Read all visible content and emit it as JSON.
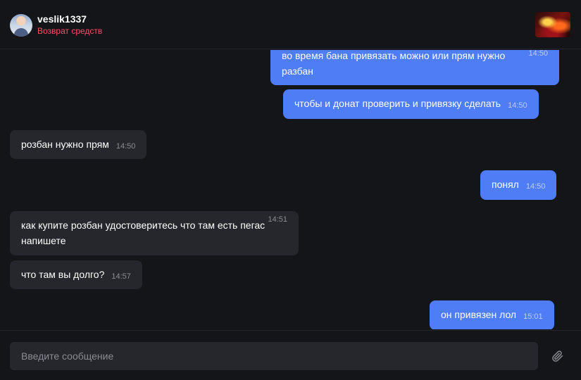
{
  "header": {
    "username": "veslik1337",
    "status": "Возврат средств",
    "status_color": "#ff4d6a"
  },
  "colors": {
    "background": "#141518",
    "outgoing_bubble": "#4f7df5",
    "incoming_bubble": "#26272d"
  },
  "messages": [
    {
      "direction": "outgoing",
      "text": "во время бана привязать можно или прям нужно разбан",
      "time": "14:50"
    },
    {
      "direction": "outgoing",
      "text": "чтобы и донат проверить и привязку сделать",
      "time": "14:50"
    },
    {
      "direction": "incoming",
      "text": "розбан нужно прям",
      "time": "14:50"
    },
    {
      "direction": "outgoing",
      "text": "понял",
      "time": "14:50"
    },
    {
      "direction": "incoming",
      "text": "как купите розбан удостоверитесь что там есть пегас напишете",
      "time": "14:51"
    },
    {
      "direction": "incoming",
      "text": "что там вы долго?",
      "time": "14:57"
    },
    {
      "direction": "outgoing",
      "text": "он привязен лол",
      "time": "15:01"
    }
  ],
  "composer": {
    "placeholder": "Введите сообщение",
    "attach_icon": "paperclip-icon"
  }
}
